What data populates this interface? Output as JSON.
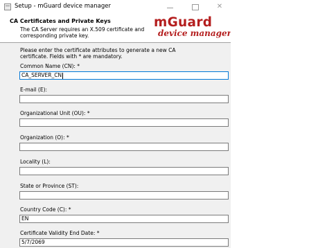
{
  "window": {
    "title": "Setup - mGuard device manager",
    "controls": {
      "minimize": "",
      "maximize": "",
      "close": "✕"
    }
  },
  "header": {
    "title": "CA Certificates and Private Keys",
    "description": "The CA Server requires an X.509 certificate and corresponding private key.",
    "logo_main": "mGuard",
    "logo_sub": "device manager",
    "brand_color": "#b41e1e"
  },
  "form": {
    "intro": "Please enter the certificate attributes to generate a new CA certificate. Fields with * are mandatory.",
    "fields": [
      {
        "label": "Common Name (CN): *",
        "value": "CA_SERVER_CN"
      },
      {
        "label": "E-mail (E):",
        "value": ""
      },
      {
        "label": "Organizational Unit (OU): *",
        "value": ""
      },
      {
        "label": "Organization (O): *",
        "value": ""
      },
      {
        "label": "Locality (L):",
        "value": ""
      },
      {
        "label": "State or Province (ST):",
        "value": ""
      },
      {
        "label": "Country Code (C): *",
        "value": "EN"
      },
      {
        "label": "Certificate Validity End Date: *",
        "value": "5/7/2069"
      }
    ]
  }
}
